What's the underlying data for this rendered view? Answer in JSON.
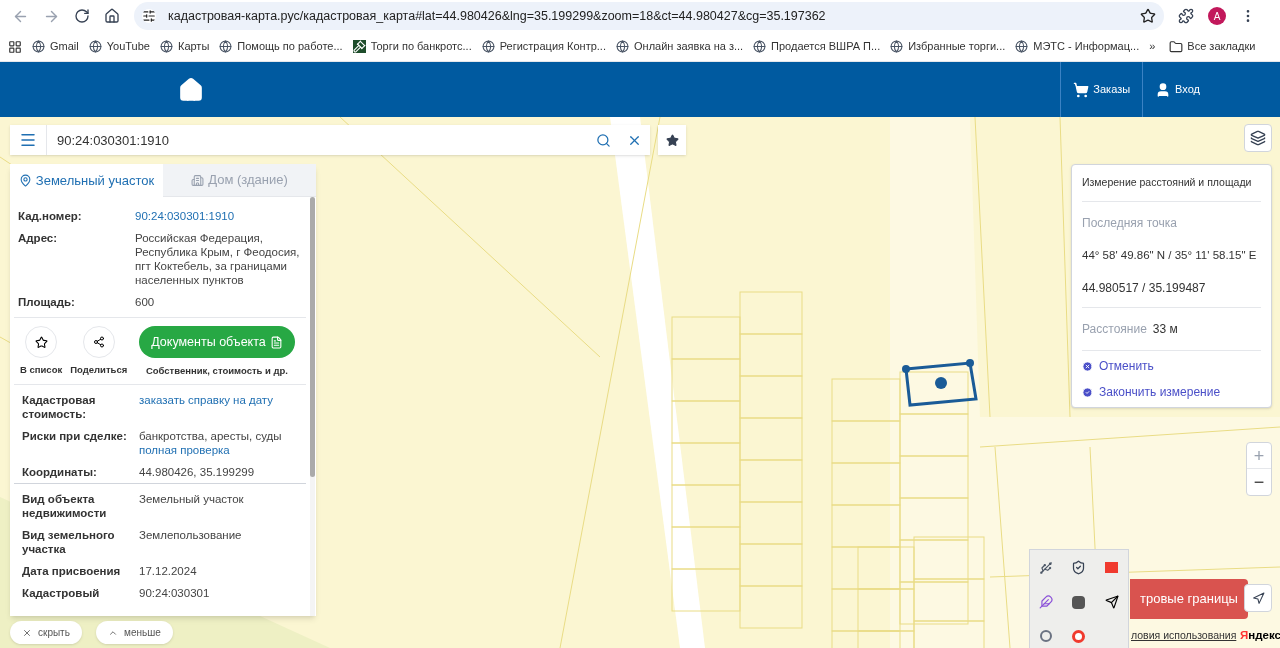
{
  "browser": {
    "url": "кадастровая-карта.рус/кадастровая_карта#lat=44.980426&lng=35.199299&zoom=18&ct=44.980427&cg=35.197362",
    "profile_initial": "A",
    "bookmarks": [
      {
        "label": "Gmail",
        "kind": "globe"
      },
      {
        "label": "YouTube",
        "kind": "globe"
      },
      {
        "label": "Карты",
        "kind": "globe"
      },
      {
        "label": "Помощь по работе...",
        "kind": "globe"
      },
      {
        "label": "Торги по банкротс...",
        "kind": "gavel"
      },
      {
        "label": "Регистрация Контр...",
        "kind": "globe"
      },
      {
        "label": "Онлайн заявка на з...",
        "kind": "globe"
      },
      {
        "label": "Продается ВШРА П...",
        "kind": "globe"
      },
      {
        "label": "Избранные торги...",
        "kind": "globe"
      },
      {
        "label": "МЭТС - Информац...",
        "kind": "globe"
      }
    ],
    "more": "»",
    "all_bookmarks": "Все закладки"
  },
  "header": {
    "orders": "Заказы",
    "login": "Вход"
  },
  "search": {
    "value": "90:24:030301:1910"
  },
  "panel": {
    "tabs": [
      {
        "label": "Земельный участок",
        "selected": true
      },
      {
        "label": "Дом (здание)",
        "selected": false
      }
    ],
    "rows_main": [
      {
        "label": "Кад.номер:",
        "value": "90:24:030301:1910",
        "kind": "link"
      },
      {
        "label": "Адрес:",
        "value": "Российская Федерация, Республика Крым, г Феодосия, пгт Коктебель, за границами населенных пунктов",
        "kind": "text"
      },
      {
        "label": "Площадь:",
        "value": "600",
        "kind": "text"
      }
    ],
    "actions": {
      "favorite": "В список",
      "share": "Поделиться",
      "documents": "Документы объекта",
      "documents_note": "Собственник, стоимость и др."
    },
    "rows_info": [
      {
        "label": "Кадастровая стоимость:",
        "value": "заказать справку на дату",
        "kind": "link"
      },
      {
        "label": "Риски при сделке:",
        "value": "банкротства, аресты, суды",
        "link": "полная проверка",
        "kind": "text_link"
      },
      {
        "label": "Координаты:",
        "value": "44.980426, 35.199299",
        "kind": "text"
      }
    ],
    "rows_details": [
      {
        "label": "Вид объекта недвижимости",
        "value": "Земельный участок",
        "kind": "text"
      },
      {
        "label": "Вид земельного участка",
        "value": "Землепользование",
        "kind": "text"
      },
      {
        "label": "Дата присвоения",
        "value": "17.12.2024",
        "kind": "text"
      },
      {
        "label": "Кадастровый",
        "value": "90:24:030301",
        "kind": "text"
      }
    ]
  },
  "bottom_buttons": {
    "hide": "скрыть",
    "less": "меньше"
  },
  "measure": {
    "title": "Измерение расстояний и площади",
    "last_point_label": "Последняя точка",
    "dms": "44° 58' 49.86\" N / 35° 11' 58.15\" E",
    "decimal": "44.980517 / 35.199487",
    "distance_label": "Расстояние",
    "distance": "33 м",
    "cancel": "Отменить",
    "finish": "Закончить измерение"
  },
  "map": {
    "boundaries_button": "тровые границы",
    "terms": "ловия использования",
    "logo": "Яндекс",
    "zoom_in": "+",
    "zoom_out": "−"
  }
}
